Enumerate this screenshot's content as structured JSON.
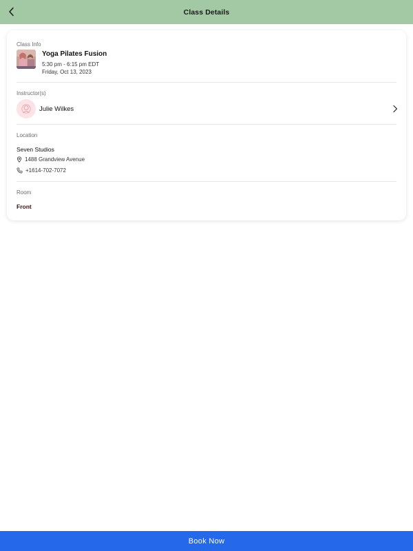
{
  "header": {
    "title": "Class Details",
    "back_icon": "chevron-left-icon",
    "background": "#a2c8a4"
  },
  "class_info": {
    "section_label": "Class Info",
    "name": "Yoga Pilates Fusion",
    "time": "5:30 pm - 6:15 pm EDT",
    "date": "Friday, Oct 13, 2023"
  },
  "instructor": {
    "section_label": "Instructor(s)",
    "name": "Julie Wilkes",
    "avatar_icon": "person-icon",
    "avatar_color": "#fbe3e6"
  },
  "location": {
    "section_label": "Location",
    "studio": "Seven Studios",
    "address": "1488 Grandview Avenue",
    "phone": "+1614-702-7072"
  },
  "room": {
    "section_label": "Room",
    "value": "Front"
  },
  "footer": {
    "book_label": "Book Now",
    "button_color": "#2569ea"
  }
}
